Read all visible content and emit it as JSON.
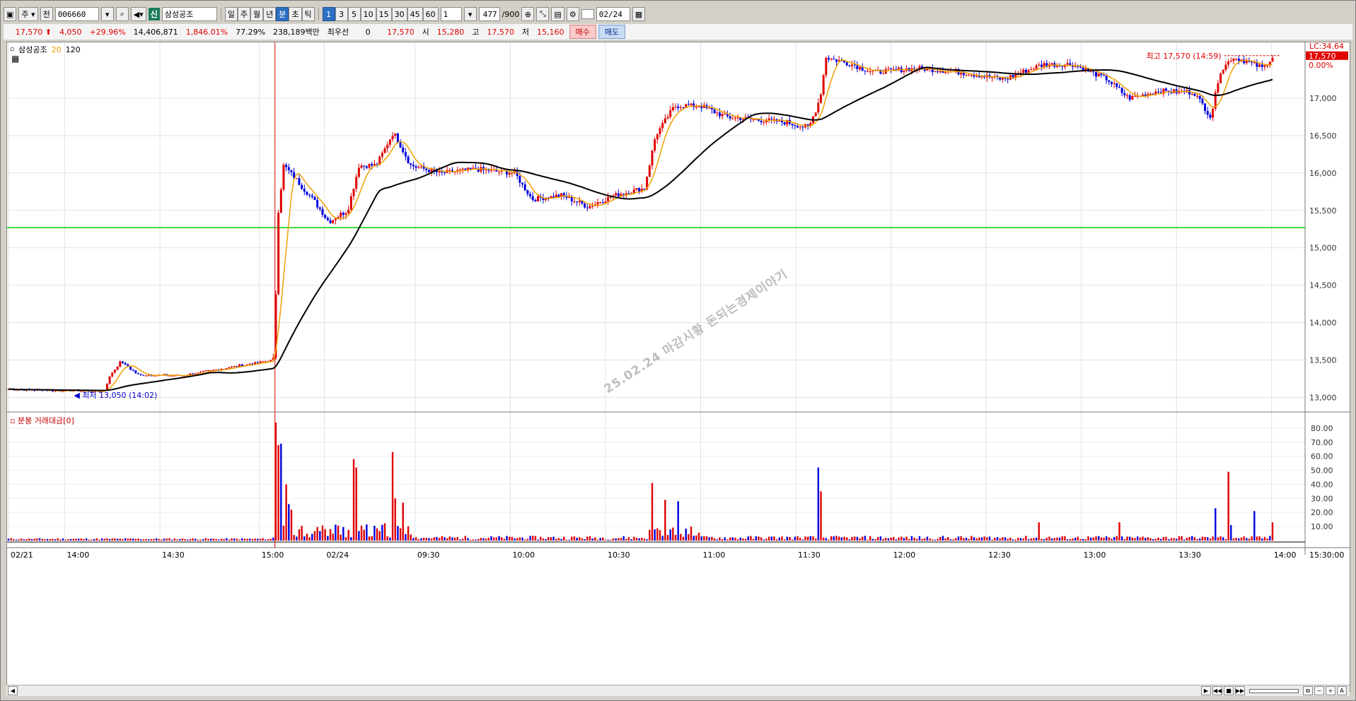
{
  "toolbar": {
    "period_select": "주",
    "prev_label": "전",
    "code": "006660",
    "sin_label": "신",
    "stock_name": "삼성공조",
    "tabs": [
      "일",
      "주",
      "월",
      "년",
      "분",
      "초",
      "틱"
    ],
    "active_tab": "분",
    "intervals": [
      "1",
      "3",
      "5",
      "10",
      "15",
      "30",
      "45",
      "60"
    ],
    "active_interval": "1",
    "custom_interval": "1",
    "count": "477",
    "count_total": "/900",
    "date": "02/24"
  },
  "quote": {
    "price": "17,570",
    "change": "4,050",
    "change_pct": "+29.96%",
    "volume": "14,406,871",
    "volume_ratio": "1,846.01%",
    "turnover": "77.29%",
    "amount": "238,189백만",
    "priority_label": "최우선",
    "priority_qty": "0",
    "priority_price": "17,570",
    "open_label": "시",
    "open": "15,280",
    "high_label": "고",
    "high": "17,570",
    "low_label": "저",
    "low": "15,160",
    "buy_label": "매수",
    "sell_label": "매도"
  },
  "chart": {
    "name": "삼성공조",
    "ma_short": "20",
    "ma_long": "120",
    "lc_label": "LC:34.64",
    "price_tag": "17,570",
    "pct_tag": "0.00%",
    "high_annot": "최고 17,570 (14:59)",
    "low_annot": "최저 13,050 (14:02)",
    "volume_panel_label": "분봉 거래대금[0]",
    "watermark": "25.02.24 마감시황 돈되는경제이야기",
    "last_time": "15:30:00",
    "colors": {
      "up": "#e00000",
      "down": "#0000e0",
      "ma20": "#f0a000",
      "ma120": "#000000",
      "hline": "#00d000",
      "cursor": "#e00000"
    }
  },
  "chart_data": {
    "type": "candlestick",
    "price_axis": {
      "ticks": [
        13000,
        13500,
        14000,
        14500,
        15000,
        15500,
        16000,
        16500,
        17000
      ],
      "range": [
        12880,
        17700
      ]
    },
    "volume_axis": {
      "ticks": [
        10,
        20,
        30,
        40,
        50,
        60,
        70,
        80
      ],
      "range": [
        0,
        88
      ]
    },
    "x_ticks": [
      "02/21",
      "14:00",
      "14:30",
      "15:00",
      "02/24",
      "09:30",
      "10:00",
      "10:30",
      "11:00",
      "11:30",
      "12:00",
      "12:30",
      "13:00",
      "13:30",
      "14:00",
      "14:30",
      "15:00"
    ],
    "horizontal_line": 15270,
    "close_anchors": [
      {
        "t": 0,
        "p": 13110
      },
      {
        "t": 60,
        "p": 13090
      },
      {
        "t": 110,
        "p": 13080
      },
      {
        "t": 118,
        "p": 13300
      },
      {
        "t": 130,
        "p": 13480
      },
      {
        "t": 150,
        "p": 13300
      },
      {
        "t": 200,
        "p": 13290
      },
      {
        "t": 240,
        "p": 13370
      },
      {
        "t": 300,
        "p": 13490
      },
      {
        "t": 308,
        "p": 13500
      },
      {
        "t": 310,
        "p": 15300
      },
      {
        "t": 318,
        "p": 16100
      },
      {
        "t": 330,
        "p": 15950
      },
      {
        "t": 355,
        "p": 15600
      },
      {
        "t": 370,
        "p": 15350
      },
      {
        "t": 392,
        "p": 15500
      },
      {
        "t": 405,
        "p": 16100
      },
      {
        "t": 425,
        "p": 16100
      },
      {
        "t": 445,
        "p": 16550
      },
      {
        "t": 465,
        "p": 16100
      },
      {
        "t": 500,
        "p": 16000
      },
      {
        "t": 540,
        "p": 16050
      },
      {
        "t": 585,
        "p": 16000
      },
      {
        "t": 605,
        "p": 15650
      },
      {
        "t": 640,
        "p": 15700
      },
      {
        "t": 670,
        "p": 15550
      },
      {
        "t": 700,
        "p": 15700
      },
      {
        "t": 735,
        "p": 15800
      },
      {
        "t": 748,
        "p": 16500
      },
      {
        "t": 770,
        "p": 16900
      },
      {
        "t": 800,
        "p": 16900
      },
      {
        "t": 830,
        "p": 16750
      },
      {
        "t": 900,
        "p": 16680
      },
      {
        "t": 925,
        "p": 16600
      },
      {
        "t": 938,
        "p": 17000
      },
      {
        "t": 945,
        "p": 17550
      },
      {
        "t": 975,
        "p": 17450
      },
      {
        "t": 1000,
        "p": 17350
      },
      {
        "t": 1050,
        "p": 17400
      },
      {
        "t": 1100,
        "p": 17350
      },
      {
        "t": 1150,
        "p": 17250
      },
      {
        "t": 1195,
        "p": 17450
      },
      {
        "t": 1230,
        "p": 17450
      },
      {
        "t": 1270,
        "p": 17250
      },
      {
        "t": 1295,
        "p": 17000
      },
      {
        "t": 1330,
        "p": 17100
      },
      {
        "t": 1370,
        "p": 17080
      },
      {
        "t": 1390,
        "p": 16750
      },
      {
        "t": 1400,
        "p": 17350
      },
      {
        "t": 1415,
        "p": 17550
      },
      {
        "t": 1430,
        "p": 17500
      },
      {
        "t": 1450,
        "p": 17400
      },
      {
        "t": 1462,
        "p": 17570
      }
    ],
    "volume_spikes": [
      {
        "t": 310,
        "v": 84
      },
      {
        "t": 313,
        "v": 68
      },
      {
        "t": 316,
        "v": 69
      },
      {
        "t": 320,
        "v": 40
      },
      {
        "t": 323,
        "v": 26
      },
      {
        "t": 326,
        "v": 22
      },
      {
        "t": 400,
        "v": 58
      },
      {
        "t": 403,
        "v": 52
      },
      {
        "t": 445,
        "v": 63
      },
      {
        "t": 448,
        "v": 30
      },
      {
        "t": 455,
        "v": 27
      },
      {
        "t": 745,
        "v": 41
      },
      {
        "t": 760,
        "v": 29
      },
      {
        "t": 775,
        "v": 28
      },
      {
        "t": 935,
        "v": 52
      },
      {
        "t": 940,
        "v": 35
      },
      {
        "t": 1190,
        "v": 13
      },
      {
        "t": 1285,
        "v": 13
      },
      {
        "t": 1395,
        "v": 23
      },
      {
        "t": 1410,
        "v": 49
      },
      {
        "t": 1414,
        "v": 11
      },
      {
        "t": 1440,
        "v": 21
      },
      {
        "t": 1460,
        "v": 13
      }
    ]
  }
}
